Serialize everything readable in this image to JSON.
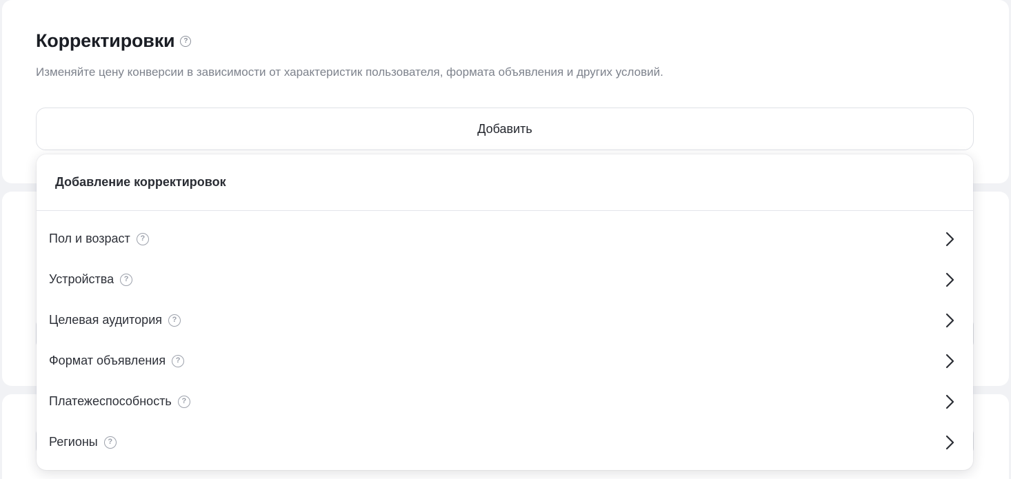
{
  "section": {
    "title": "Корректировки",
    "description": "Изменяйте цену конверсии в зависимости от характеристик пользователя, формата объявления и других условий.",
    "add_label": "Добавить"
  },
  "dropdown": {
    "title": "Добавление корректировок",
    "items": [
      {
        "label": "Пол и возраст",
        "icon": "help-icon"
      },
      {
        "label": "Устройства",
        "icon": "help-icon"
      },
      {
        "label": "Целевая аудитория",
        "icon": "help-icon"
      },
      {
        "label": "Формат объявления",
        "icon": "help-icon"
      },
      {
        "label": "Платежеспособность",
        "icon": "help-icon"
      },
      {
        "label": "Регионы",
        "icon": "help-icon"
      }
    ]
  },
  "colors": {
    "background": "#f1f2f5",
    "card": "#ffffff",
    "text_primary": "#1a1d24",
    "text_secondary": "#7d828c",
    "border": "#dfe1e6"
  }
}
